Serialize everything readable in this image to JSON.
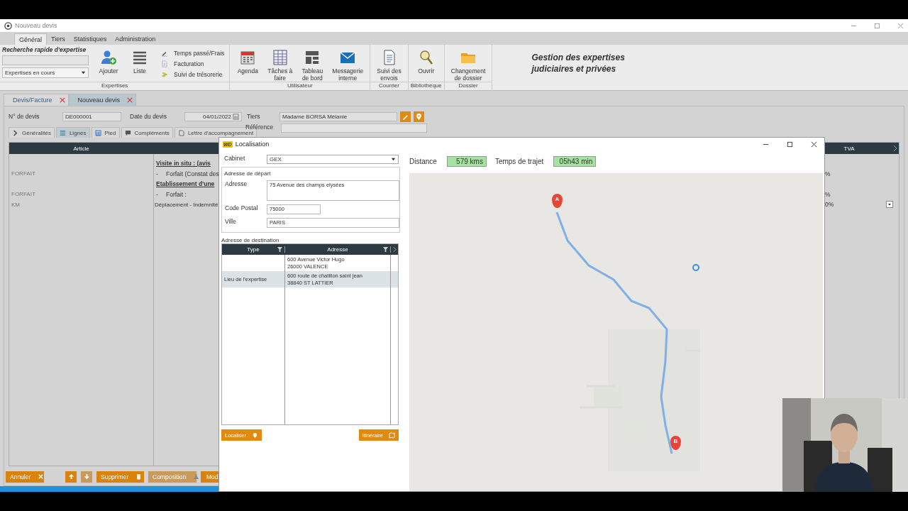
{
  "window": {
    "title": "Nouveau devis"
  },
  "ribbon_tabs": [
    {
      "label": "Général",
      "selected": true
    },
    {
      "label": "Tiers",
      "selected": false
    },
    {
      "label": "Statistiques",
      "selected": false
    },
    {
      "label": "Administration",
      "selected": false
    }
  ],
  "ribbon": {
    "groups": [
      {
        "label": "Expertises",
        "quick_search": {
          "title": "Recherche rapide d'expertise",
          "filter": "Expertises en cours"
        },
        "buttons": [
          {
            "lines": [
              "Ajouter"
            ]
          },
          {
            "lines": [
              "Liste"
            ]
          }
        ],
        "links": [
          "Temps passé/Frais",
          "Facturation",
          "Suivi de trésorerie"
        ]
      },
      {
        "label": "Utilisateur",
        "buttons": [
          {
            "lines": [
              "Agenda"
            ]
          },
          {
            "lines": [
              "Tâches à",
              "faire"
            ]
          },
          {
            "lines": [
              "Tableau",
              "de bord"
            ]
          },
          {
            "lines": [
              "Messagerie",
              "interne"
            ]
          }
        ]
      },
      {
        "label": "Courrier",
        "buttons": [
          {
            "lines": [
              "Suivi des",
              "envois"
            ]
          }
        ]
      },
      {
        "label": "Bibliothèque",
        "buttons": [
          {
            "lines": [
              "Ouvrir"
            ]
          }
        ]
      },
      {
        "label": "Dossier",
        "buttons": [
          {
            "lines": [
              "Changement",
              "de dossier"
            ]
          }
        ]
      }
    ],
    "brand": [
      "Gestion des expertises",
      "judiciaires et privées"
    ]
  },
  "doc_tabs": [
    {
      "label": "Devis/Facture",
      "selected": false
    },
    {
      "label": "Nouveau devis",
      "selected": true
    }
  ],
  "form": {
    "fields": [
      {
        "label": "N° de devis",
        "value": "DE000001"
      },
      {
        "label": "Date du devis",
        "value": "04/01/2022"
      },
      {
        "label": "Tiers",
        "value": "Madame BORSA Mélanie"
      }
    ],
    "reference_label": "Référence",
    "subtabs": [
      {
        "label": "Généralités",
        "selected": false
      },
      {
        "label": "Lignes",
        "selected": true
      },
      {
        "label": "Pied",
        "selected": false
      },
      {
        "label": "Compléments",
        "selected": false
      },
      {
        "label": "Lettre d'accompagnement",
        "selected": false
      }
    ],
    "table": {
      "columns": [
        "Article",
        "TVA"
      ],
      "rows": [
        {
          "kind": "heading",
          "description": "Visite in situ : (avis",
          "has_dropdown": false
        },
        {
          "kind": "item",
          "article": "FORFAIT",
          "bullet": "-",
          "description": "Forfait (Constat des",
          "tva": "%",
          "has_dropdown": false
        },
        {
          "kind": "heading",
          "description": "Etablissement d'une",
          "has_dropdown": false
        },
        {
          "kind": "item",
          "article": "FORFAIT",
          "bullet": "-",
          "description": "Forfait :",
          "tva": "%",
          "has_dropdown": false
        },
        {
          "kind": "plain",
          "article": "KM",
          "description": "Déplacement - Indemnité",
          "tva": "0%",
          "has_dropdown": true
        }
      ]
    },
    "buttons": [
      {
        "kind": "cancel",
        "label": "Annuler",
        "disabled": false
      },
      {
        "kind": "up",
        "disabled": false
      },
      {
        "kind": "down",
        "disabled": true
      },
      {
        "kind": "delete",
        "label": "Supprimer",
        "disabled": false
      },
      {
        "kind": "compose",
        "label": "Composition",
        "disabled": true
      },
      {
        "kind": "plain",
        "label": "Mod",
        "disabled": false
      }
    ]
  },
  "dialog": {
    "logo": "WD",
    "title": "Localisation",
    "cabinet_label": "Cabinet",
    "cabinet": "GEX",
    "departure": {
      "legend": "Adresse de départ",
      "fields": [
        {
          "kind": "area",
          "label": "Adresse",
          "value": "75 Avenue des champs elysées"
        },
        {
          "kind": "short",
          "label": "Code Postal",
          "value": "75000"
        },
        {
          "kind": "long",
          "label": "Ville",
          "value": "PARIS"
        }
      ]
    },
    "destination": {
      "title": "Adresse de destination",
      "columns": [
        "Type",
        "Adresse"
      ],
      "rows": [
        {
          "address": [
            "600 Avenue Victor Hugo",
            "26000 VALENCE"
          ],
          "selected": false
        },
        {
          "type": "Lieu de l'expertise",
          "address": [
            "600 route de chatillon saint jean",
            "38840 ST LATTIER"
          ],
          "selected": true
        }
      ]
    },
    "buttons": [
      {
        "kind": "locate",
        "label": "Localiser"
      },
      {
        "kind": "route",
        "label": "Itinéraire"
      }
    ],
    "distance_label": "Distance",
    "distance": "579 kms",
    "time_label": "Temps de trajet",
    "time": "05h43 min",
    "map": {
      "kind": "picture",
      "markers": [
        "A",
        "B"
      ]
    }
  }
}
